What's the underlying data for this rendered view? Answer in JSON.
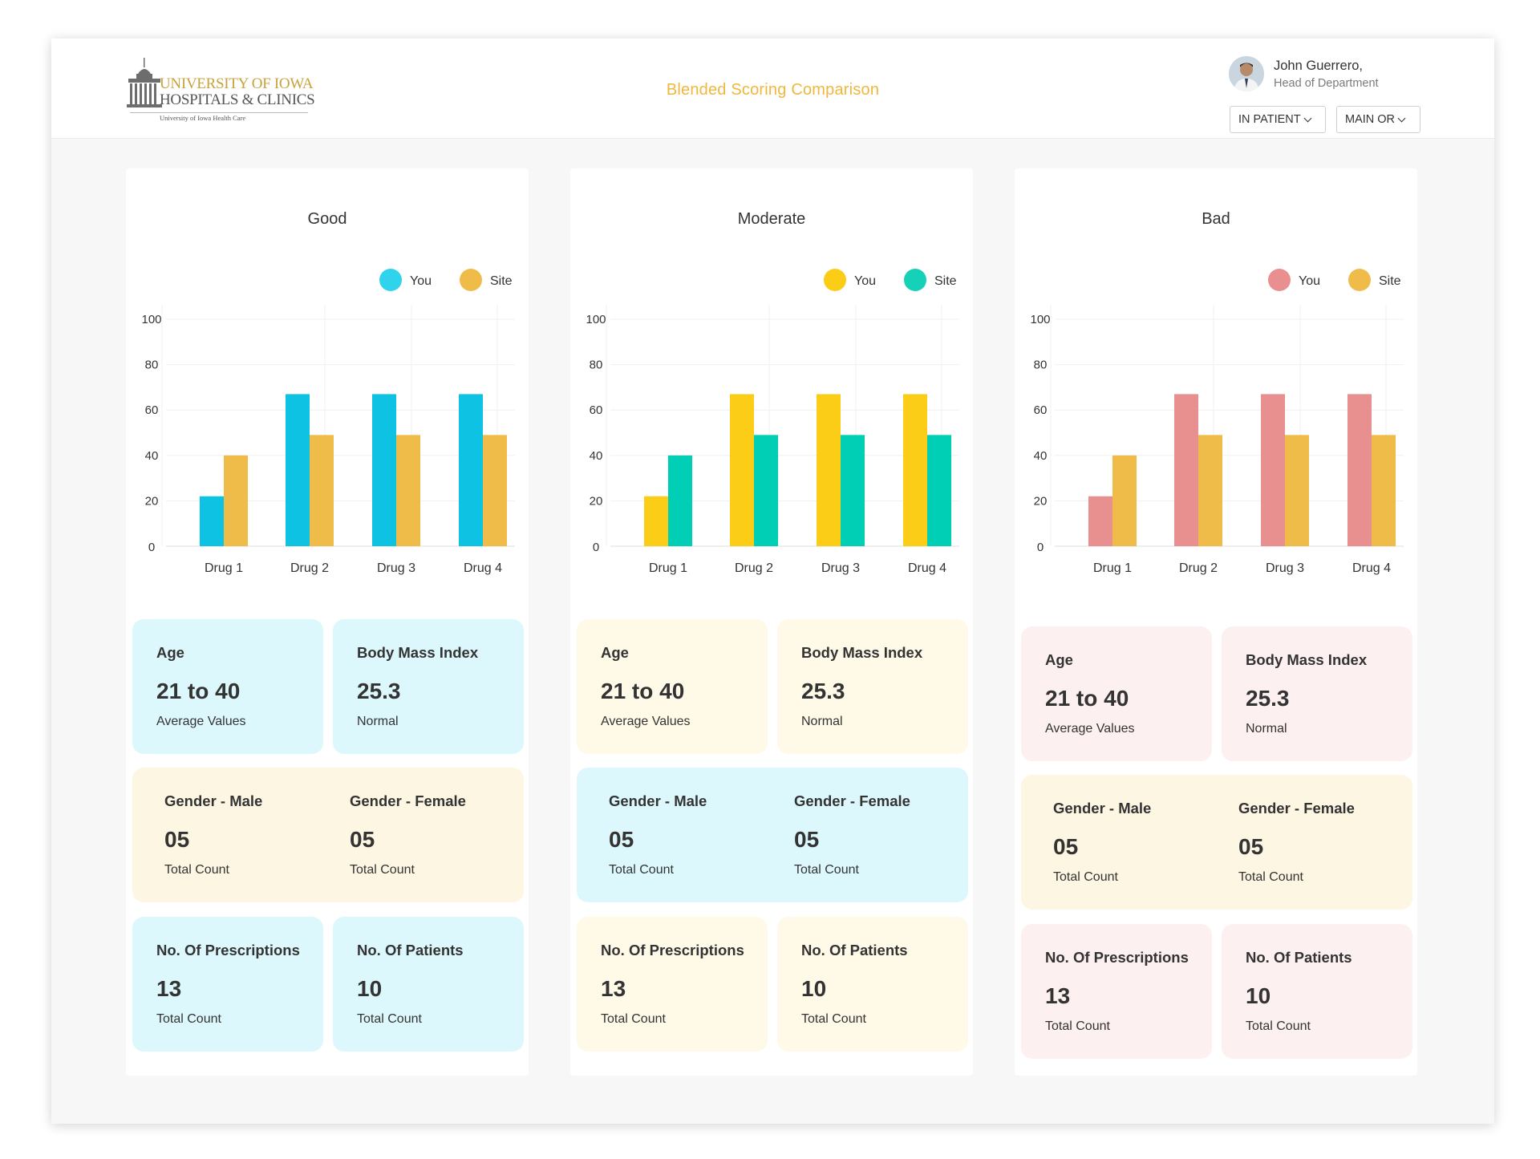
{
  "header": {
    "logo": {
      "line1": "UNIVERSITY OF IOWA",
      "line2": "HOSPITALS & CLINICS",
      "line3": "University of Iowa Health Care"
    },
    "title": "Blended Scoring Comparison",
    "user": {
      "name": "John Guerrero,",
      "role": "Head of Department"
    },
    "filters": [
      {
        "label": "IN PATIENT"
      },
      {
        "label": "MAIN OR"
      }
    ]
  },
  "panels": [
    {
      "title": "Good",
      "legend": [
        "You",
        "Site"
      ],
      "colors": {
        "you": "#0ec2e4",
        "site": "#f0bc49",
        "legend_you": "#30d3ec",
        "legend_site": "#f0bc49"
      },
      "cards": {
        "age": {
          "label": "Age",
          "value": "21 to 40",
          "sub": "Average Values"
        },
        "bmi": {
          "label": "Body Mass Index",
          "value": "25.3",
          "sub": "Normal"
        },
        "gender_male": {
          "label": "Gender - Male",
          "value": "05",
          "sub": "Total Count"
        },
        "gender_female": {
          "label": "Gender - Female",
          "value": "05",
          "sub": "Total Count"
        },
        "prescriptions": {
          "label": "No. Of Prescriptions",
          "value": "13",
          "sub": "Total Count"
        },
        "patients": {
          "label": "No. Of Patients",
          "value": "10",
          "sub": "Total Count"
        }
      },
      "card_colors": {
        "a": "#dcf8fc",
        "b": "#fdf6e2",
        "c": "#dcf8fc"
      }
    },
    {
      "title": "Moderate",
      "legend": [
        "You",
        "Site"
      ],
      "colors": {
        "you": "#fbcd17",
        "site": "#00cfb5",
        "legend_you": "#fbcd17",
        "legend_site": "#14d1b7"
      },
      "cards": {
        "age": {
          "label": "Age",
          "value": "21 to 40",
          "sub": "Average Values"
        },
        "bmi": {
          "label": "Body Mass Index",
          "value": "25.3",
          "sub": "Normal"
        },
        "gender_male": {
          "label": "Gender - Male",
          "value": "05",
          "sub": "Total Count"
        },
        "gender_female": {
          "label": "Gender - Female",
          "value": "05",
          "sub": "Total Count"
        },
        "prescriptions": {
          "label": "No. Of Prescriptions",
          "value": "13",
          "sub": "Total Count"
        },
        "patients": {
          "label": "No. Of Patients",
          "value": "10",
          "sub": "Total Count"
        }
      },
      "card_colors": {
        "a": "#fff9e8",
        "b": "#dcf8fc",
        "c": "#fff9e8"
      }
    },
    {
      "title": "Bad",
      "legend": [
        "You",
        "Site"
      ],
      "colors": {
        "you": "#e88f8f",
        "site": "#f0bc49",
        "legend_you": "#ea8f8f",
        "legend_site": "#f0bc49"
      },
      "cards": {
        "age": {
          "label": "Age",
          "value": "21 to 40",
          "sub": "Average Values"
        },
        "bmi": {
          "label": "Body Mass Index",
          "value": "25.3",
          "sub": "Normal"
        },
        "gender_male": {
          "label": "Gender - Male",
          "value": "05",
          "sub": "Total Count"
        },
        "gender_female": {
          "label": "Gender - Female",
          "value": "05",
          "sub": "Total Count"
        },
        "prescriptions": {
          "label": "No. Of Prescriptions",
          "value": "13",
          "sub": "Total Count"
        },
        "patients": {
          "label": "No. Of Patients",
          "value": "10",
          "sub": "Total Count"
        }
      },
      "card_colors": {
        "a": "#fdf0f0",
        "b": "#fdf6e2",
        "c": "#fdf0f0"
      }
    }
  ],
  "chart_data": [
    {
      "type": "bar",
      "title": "Good",
      "categories": [
        "Drug 1",
        "Drug 2",
        "Drug 3",
        "Drug 4"
      ],
      "series": [
        {
          "name": "You",
          "values": [
            22,
            67,
            67,
            67
          ]
        },
        {
          "name": "Site",
          "values": [
            40,
            49,
            49,
            49
          ]
        }
      ],
      "yticks": [
        "0",
        "20",
        "40",
        "60",
        "80",
        "100"
      ],
      "ylim": [
        0,
        100
      ],
      "grid": true,
      "legend": "top-right"
    },
    {
      "type": "bar",
      "title": "Moderate",
      "categories": [
        "Drug 1",
        "Drug 2",
        "Drug 3",
        "Drug 4"
      ],
      "series": [
        {
          "name": "You",
          "values": [
            22,
            67,
            67,
            67
          ]
        },
        {
          "name": "Site",
          "values": [
            40,
            49,
            49,
            49
          ]
        }
      ],
      "yticks": [
        "0",
        "20",
        "40",
        "60",
        "80",
        "100"
      ],
      "ylim": [
        0,
        100
      ],
      "grid": true,
      "legend": "top-right"
    },
    {
      "type": "bar",
      "title": "Bad",
      "categories": [
        "Drug 1",
        "Drug 2",
        "Drug 3",
        "Drug 4"
      ],
      "series": [
        {
          "name": "You",
          "values": [
            22,
            67,
            67,
            67
          ]
        },
        {
          "name": "Site",
          "values": [
            40,
            49,
            49,
            49
          ]
        }
      ],
      "yticks": [
        "0",
        "20",
        "40",
        "60",
        "80",
        "100"
      ],
      "ylim": [
        0,
        100
      ],
      "grid": true,
      "legend": "top-right"
    }
  ]
}
